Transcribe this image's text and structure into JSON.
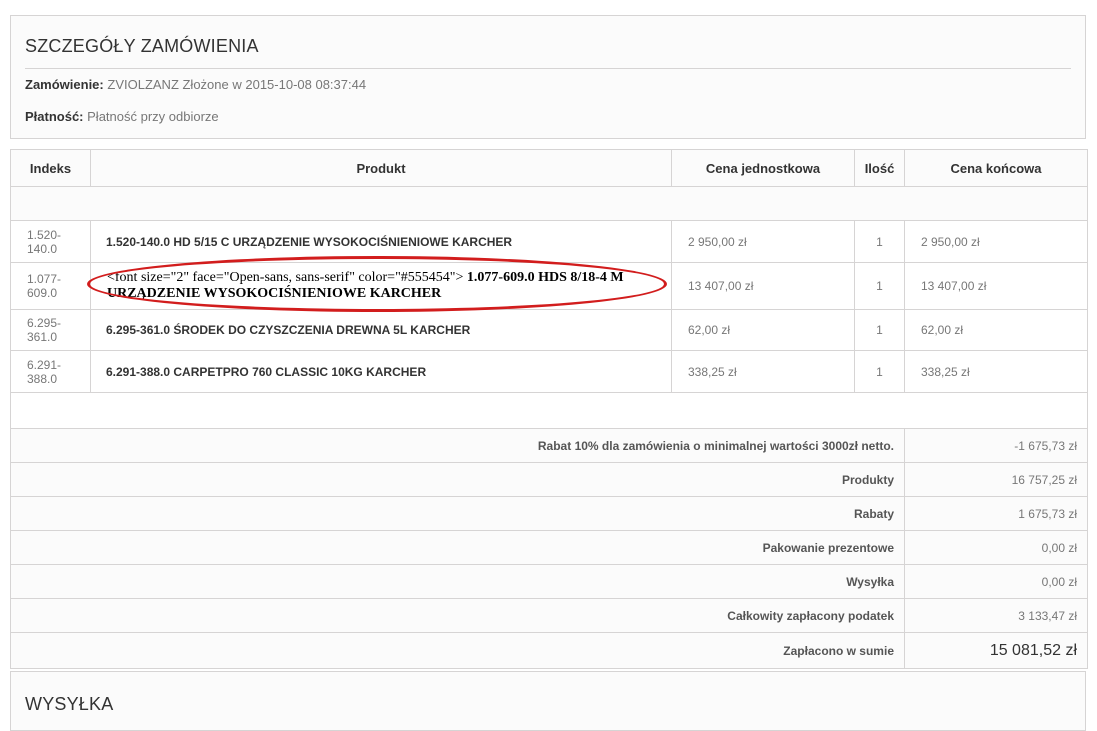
{
  "details": {
    "title": "SZCZEGÓŁY ZAMÓWIENIA",
    "order_label": "Zamówienie:",
    "order_value": "ZVIOLZANZ Złożone w 2015-10-08 08:37:44",
    "payment_label": "Płatność:",
    "payment_value": "Płatność przy odbiorze"
  },
  "table": {
    "headers": {
      "index": "Indeks",
      "product": "Produkt",
      "unit_price": "Cena jednostkowa",
      "qty": "Ilość",
      "total": "Cena końcowa"
    },
    "rows": [
      {
        "index_a": "1.520-",
        "index_b": "140.0",
        "product": "1.520-140.0 HD 5/15 C URZĄDZENIE WYSOKOCIŚNIENIOWE KARCHER",
        "unit_price": "2 950,00 zł",
        "qty": "1",
        "total": "2 950,00 zł"
      },
      {
        "index_a": "1.077-",
        "index_b": "609.0",
        "product_raw": "<font size=\"2\" face=\"Open-sans, sans-serif\" color=\"#555454\">",
        "product_bold": "1.077-609.0 HDS 8/18-4 M URZĄDZENIE WYSOKOCIŚNIENIOWE KARCHER",
        "unit_price": "13 407,00 zł",
        "qty": "1",
        "total": "13 407,00 zł"
      },
      {
        "index_a": "6.295-",
        "index_b": "361.0",
        "product": "6.295-361.0 ŚRODEK DO CZYSZCZENIA DREWNA 5L KARCHER",
        "unit_price": "62,00 zł",
        "qty": "1",
        "total": "62,00 zł"
      },
      {
        "index_a": "6.291-",
        "index_b": "388.0",
        "product": "6.291-388.0 CARPETPRO 760 CLASSIC 10KG KARCHER",
        "unit_price": "338,25 zł",
        "qty": "1",
        "total": "338,25 zł"
      }
    ]
  },
  "summary": [
    {
      "label": "Rabat 10% dla zamówienia o minimalnej wartości 3000zł netto.",
      "value": "-1 675,73 zł"
    },
    {
      "label": "Produkty",
      "value": "16 757,25 zł"
    },
    {
      "label": "Rabaty",
      "value": "1 675,73 zł"
    },
    {
      "label": "Pakowanie prezentowe",
      "value": "0,00 zł"
    },
    {
      "label": "Wysyłka",
      "value": "0,00 zł"
    },
    {
      "label": "Całkowity zapłacony podatek",
      "value": "3 133,47 zł"
    },
    {
      "label": "Zapłacono w sumie",
      "value": "15 081,52 zł"
    }
  ],
  "shipping": {
    "title": "WYSYŁKA"
  },
  "colors": {
    "highlight_ellipse": "#d21d1d",
    "border": "#d6d4d4",
    "text": "#555454"
  }
}
